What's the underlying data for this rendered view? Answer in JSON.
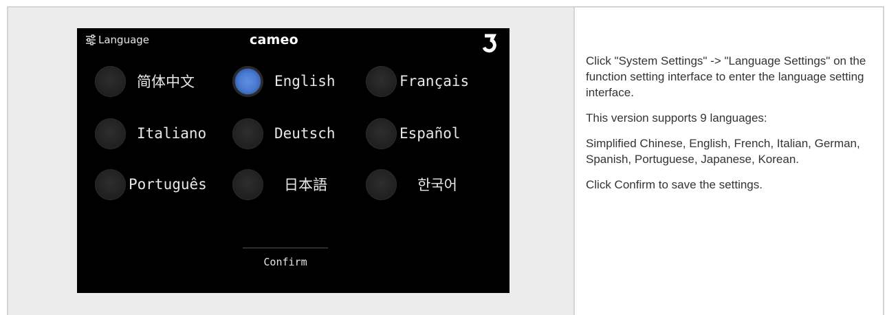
{
  "device": {
    "title": "Language",
    "brand": "cameo",
    "confirm_label": "Confirm",
    "selected_language": "English",
    "languages": [
      {
        "label": "简体中文"
      },
      {
        "label": "English"
      },
      {
        "label": "Français"
      },
      {
        "label": "Italiano"
      },
      {
        "label": "Deutsch"
      },
      {
        "label": "Español"
      },
      {
        "label": "Português"
      },
      {
        "label": "日本語"
      },
      {
        "label": "한국어"
      }
    ],
    "icons": {
      "title_icon": "sliders-icon",
      "back_icon": "back-arrow-icon"
    },
    "colors": {
      "screen_bg": "#000000",
      "selected_radio": "#4a7bd2"
    }
  },
  "description": {
    "paragraphs": [
      "Click \"System Settings\" -> \"Language Settings\" on the function setting interface to enter the language setting interface.",
      "This version supports 9 languages:",
      "Simplified Chinese, English, French, Italian, German, Spanish, Portuguese, Japanese, Korean.",
      "Click Confirm to save the settings."
    ]
  }
}
